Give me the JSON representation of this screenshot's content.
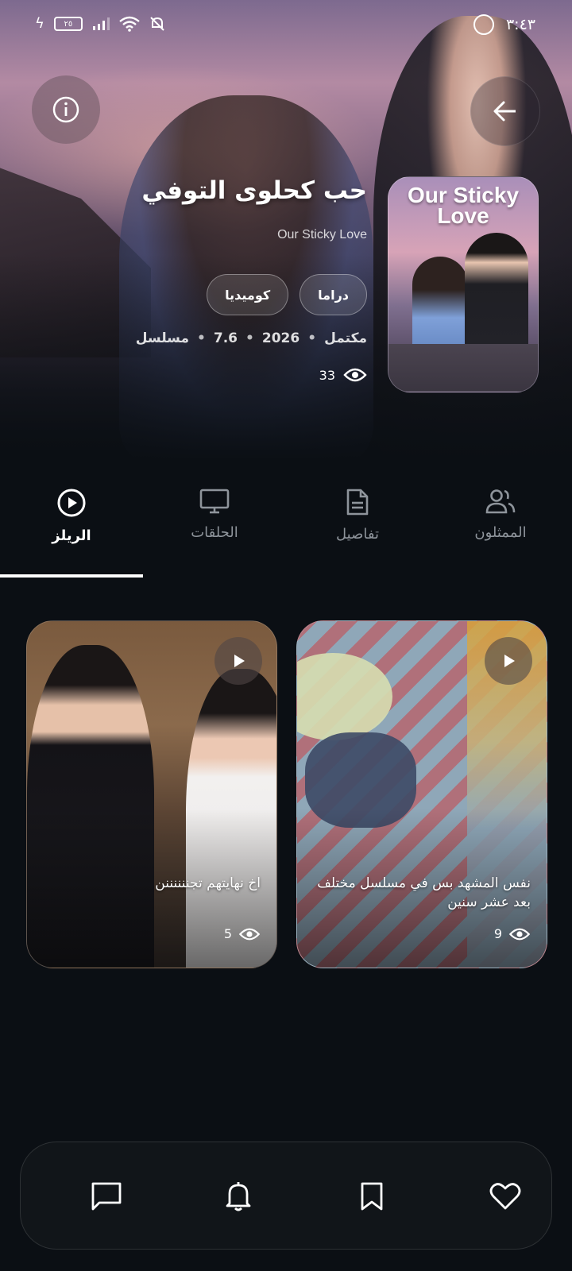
{
  "status_bar": {
    "time": "٣:٤٣",
    "battery": "٢٥"
  },
  "show": {
    "title_ar": "حب كحلوى التوفي",
    "title_en": "Our Sticky Love",
    "poster_text": "Our Sticky Love",
    "genres": [
      "دراما",
      "كوميديا"
    ],
    "meta": {
      "type": "مسلسل",
      "rating": "7.6",
      "year": "2026",
      "status": "مكتمل",
      "separator": "•"
    },
    "views": "33"
  },
  "tabs": [
    {
      "label": "الممثلون",
      "icon": "people-icon",
      "active": false
    },
    {
      "label": "تفاصيل",
      "icon": "document-icon",
      "active": false
    },
    {
      "label": "الحلقات",
      "icon": "tv-icon",
      "active": false
    },
    {
      "label": "الريلز",
      "icon": "play-circle-icon",
      "active": true
    }
  ],
  "reels": [
    {
      "caption": "نفس المشهد بس في مسلسل مختلف بعد عشر سنين",
      "views": "9"
    },
    {
      "caption": "اخ نهايتهم تجننننننن",
      "views": "5"
    }
  ],
  "bottom_bar": [
    {
      "icon": "heart-icon"
    },
    {
      "icon": "bookmark-icon"
    },
    {
      "icon": "bell-icon"
    },
    {
      "icon": "chat-icon"
    }
  ],
  "colors": {
    "background": "#0b0f14",
    "tab_active": "#ffffff",
    "tab_inactive": "#8e949b"
  }
}
